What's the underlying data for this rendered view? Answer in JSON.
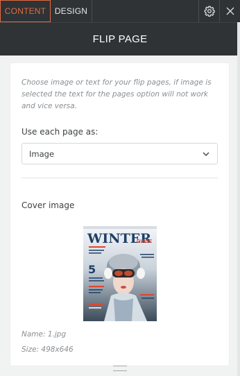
{
  "tabs": {
    "content": "CONTENT",
    "design": "DESIGN"
  },
  "icons": {
    "settings": "gear-icon",
    "close": "close-icon",
    "dropdown": "chevron-down-icon"
  },
  "header": {
    "title": "FLIP PAGE"
  },
  "panel": {
    "help_text": "Choose image or text for your flip pages, if image is selected the text for the pages option will not work and vice versa.",
    "use_each_page_label": "Use each page as:",
    "use_each_page_value": "Image",
    "cover_image_label": "Cover image",
    "file_name": "Name: 1.jpg",
    "file_size": "Size: 498x646"
  },
  "magazine": {
    "masthead": "WINTER",
    "tag": "GUIDE",
    "feature_number": "5"
  },
  "colors": {
    "accent": "#e26a3f",
    "topbar": "#2f3336",
    "panel_bg": "#f1f2f2"
  }
}
